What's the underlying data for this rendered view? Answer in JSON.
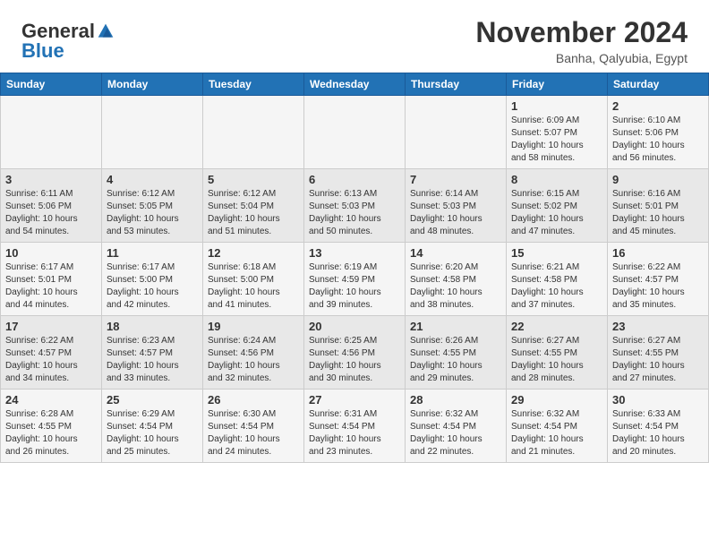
{
  "header": {
    "logo": {
      "general": "General",
      "blue": "Blue"
    },
    "title": "November 2024",
    "location": "Banha, Qalyubia, Egypt"
  },
  "calendar": {
    "weekdays": [
      "Sunday",
      "Monday",
      "Tuesday",
      "Wednesday",
      "Thursday",
      "Friday",
      "Saturday"
    ],
    "weeks": [
      [
        {
          "day": "",
          "info": ""
        },
        {
          "day": "",
          "info": ""
        },
        {
          "day": "",
          "info": ""
        },
        {
          "day": "",
          "info": ""
        },
        {
          "day": "",
          "info": ""
        },
        {
          "day": "1",
          "info": "Sunrise: 6:09 AM\nSunset: 5:07 PM\nDaylight: 10 hours\nand 58 minutes."
        },
        {
          "day": "2",
          "info": "Sunrise: 6:10 AM\nSunset: 5:06 PM\nDaylight: 10 hours\nand 56 minutes."
        }
      ],
      [
        {
          "day": "3",
          "info": "Sunrise: 6:11 AM\nSunset: 5:06 PM\nDaylight: 10 hours\nand 54 minutes."
        },
        {
          "day": "4",
          "info": "Sunrise: 6:12 AM\nSunset: 5:05 PM\nDaylight: 10 hours\nand 53 minutes."
        },
        {
          "day": "5",
          "info": "Sunrise: 6:12 AM\nSunset: 5:04 PM\nDaylight: 10 hours\nand 51 minutes."
        },
        {
          "day": "6",
          "info": "Sunrise: 6:13 AM\nSunset: 5:03 PM\nDaylight: 10 hours\nand 50 minutes."
        },
        {
          "day": "7",
          "info": "Sunrise: 6:14 AM\nSunset: 5:03 PM\nDaylight: 10 hours\nand 48 minutes."
        },
        {
          "day": "8",
          "info": "Sunrise: 6:15 AM\nSunset: 5:02 PM\nDaylight: 10 hours\nand 47 minutes."
        },
        {
          "day": "9",
          "info": "Sunrise: 6:16 AM\nSunset: 5:01 PM\nDaylight: 10 hours\nand 45 minutes."
        }
      ],
      [
        {
          "day": "10",
          "info": "Sunrise: 6:17 AM\nSunset: 5:01 PM\nDaylight: 10 hours\nand 44 minutes."
        },
        {
          "day": "11",
          "info": "Sunrise: 6:17 AM\nSunset: 5:00 PM\nDaylight: 10 hours\nand 42 minutes."
        },
        {
          "day": "12",
          "info": "Sunrise: 6:18 AM\nSunset: 5:00 PM\nDaylight: 10 hours\nand 41 minutes."
        },
        {
          "day": "13",
          "info": "Sunrise: 6:19 AM\nSunset: 4:59 PM\nDaylight: 10 hours\nand 39 minutes."
        },
        {
          "day": "14",
          "info": "Sunrise: 6:20 AM\nSunset: 4:58 PM\nDaylight: 10 hours\nand 38 minutes."
        },
        {
          "day": "15",
          "info": "Sunrise: 6:21 AM\nSunset: 4:58 PM\nDaylight: 10 hours\nand 37 minutes."
        },
        {
          "day": "16",
          "info": "Sunrise: 6:22 AM\nSunset: 4:57 PM\nDaylight: 10 hours\nand 35 minutes."
        }
      ],
      [
        {
          "day": "17",
          "info": "Sunrise: 6:22 AM\nSunset: 4:57 PM\nDaylight: 10 hours\nand 34 minutes."
        },
        {
          "day": "18",
          "info": "Sunrise: 6:23 AM\nSunset: 4:57 PM\nDaylight: 10 hours\nand 33 minutes."
        },
        {
          "day": "19",
          "info": "Sunrise: 6:24 AM\nSunset: 4:56 PM\nDaylight: 10 hours\nand 32 minutes."
        },
        {
          "day": "20",
          "info": "Sunrise: 6:25 AM\nSunset: 4:56 PM\nDaylight: 10 hours\nand 30 minutes."
        },
        {
          "day": "21",
          "info": "Sunrise: 6:26 AM\nSunset: 4:55 PM\nDaylight: 10 hours\nand 29 minutes."
        },
        {
          "day": "22",
          "info": "Sunrise: 6:27 AM\nSunset: 4:55 PM\nDaylight: 10 hours\nand 28 minutes."
        },
        {
          "day": "23",
          "info": "Sunrise: 6:27 AM\nSunset: 4:55 PM\nDaylight: 10 hours\nand 27 minutes."
        }
      ],
      [
        {
          "day": "24",
          "info": "Sunrise: 6:28 AM\nSunset: 4:55 PM\nDaylight: 10 hours\nand 26 minutes."
        },
        {
          "day": "25",
          "info": "Sunrise: 6:29 AM\nSunset: 4:54 PM\nDaylight: 10 hours\nand 25 minutes."
        },
        {
          "day": "26",
          "info": "Sunrise: 6:30 AM\nSunset: 4:54 PM\nDaylight: 10 hours\nand 24 minutes."
        },
        {
          "day": "27",
          "info": "Sunrise: 6:31 AM\nSunset: 4:54 PM\nDaylight: 10 hours\nand 23 minutes."
        },
        {
          "day": "28",
          "info": "Sunrise: 6:32 AM\nSunset: 4:54 PM\nDaylight: 10 hours\nand 22 minutes."
        },
        {
          "day": "29",
          "info": "Sunrise: 6:32 AM\nSunset: 4:54 PM\nDaylight: 10 hours\nand 21 minutes."
        },
        {
          "day": "30",
          "info": "Sunrise: 6:33 AM\nSunset: 4:54 PM\nDaylight: 10 hours\nand 20 minutes."
        }
      ]
    ]
  }
}
